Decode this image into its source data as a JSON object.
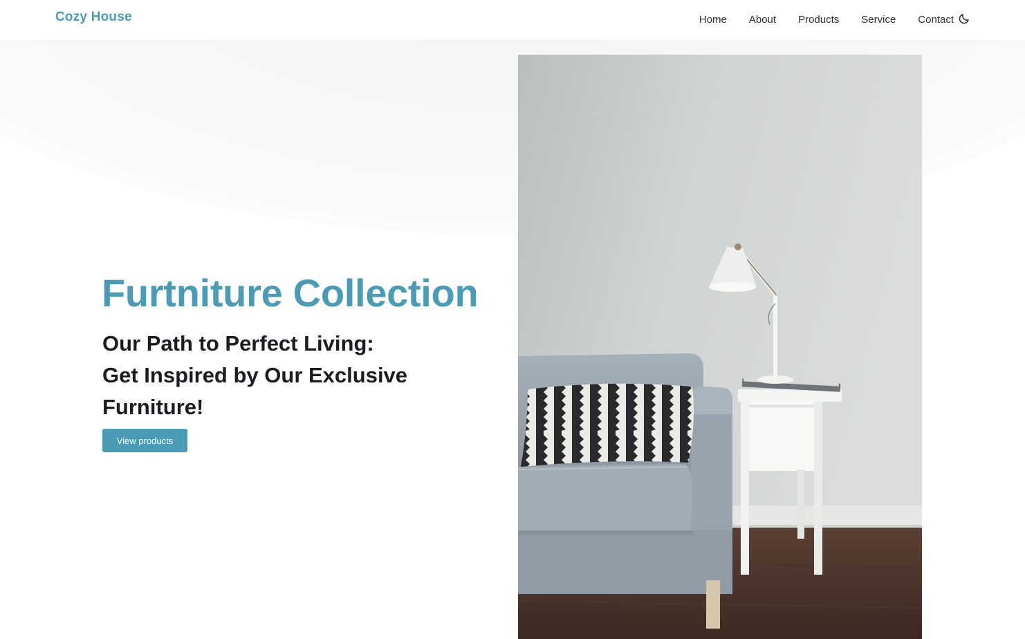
{
  "brand": {
    "name": "Cozy House"
  },
  "nav": {
    "items": [
      {
        "label": "Home"
      },
      {
        "label": "About"
      },
      {
        "label": "Products"
      },
      {
        "label": "Service"
      },
      {
        "label": "Contact"
      }
    ],
    "theme_toggle_icon": "moon-icon"
  },
  "hero": {
    "title": "Furtniture Collection",
    "subtitle_lines": [
      "Our Path to Perfect Living:",
      "Get Inspired by Our Exclusive",
      "Furniture!"
    ],
    "cta_label": "View products",
    "image_subject": "sofa-with-lamp-photo"
  },
  "colors": {
    "accent": "#4a9bb5",
    "heading_text": "#1d1a22",
    "nav_text": "#2b2b2b",
    "background": "#ffffff"
  }
}
